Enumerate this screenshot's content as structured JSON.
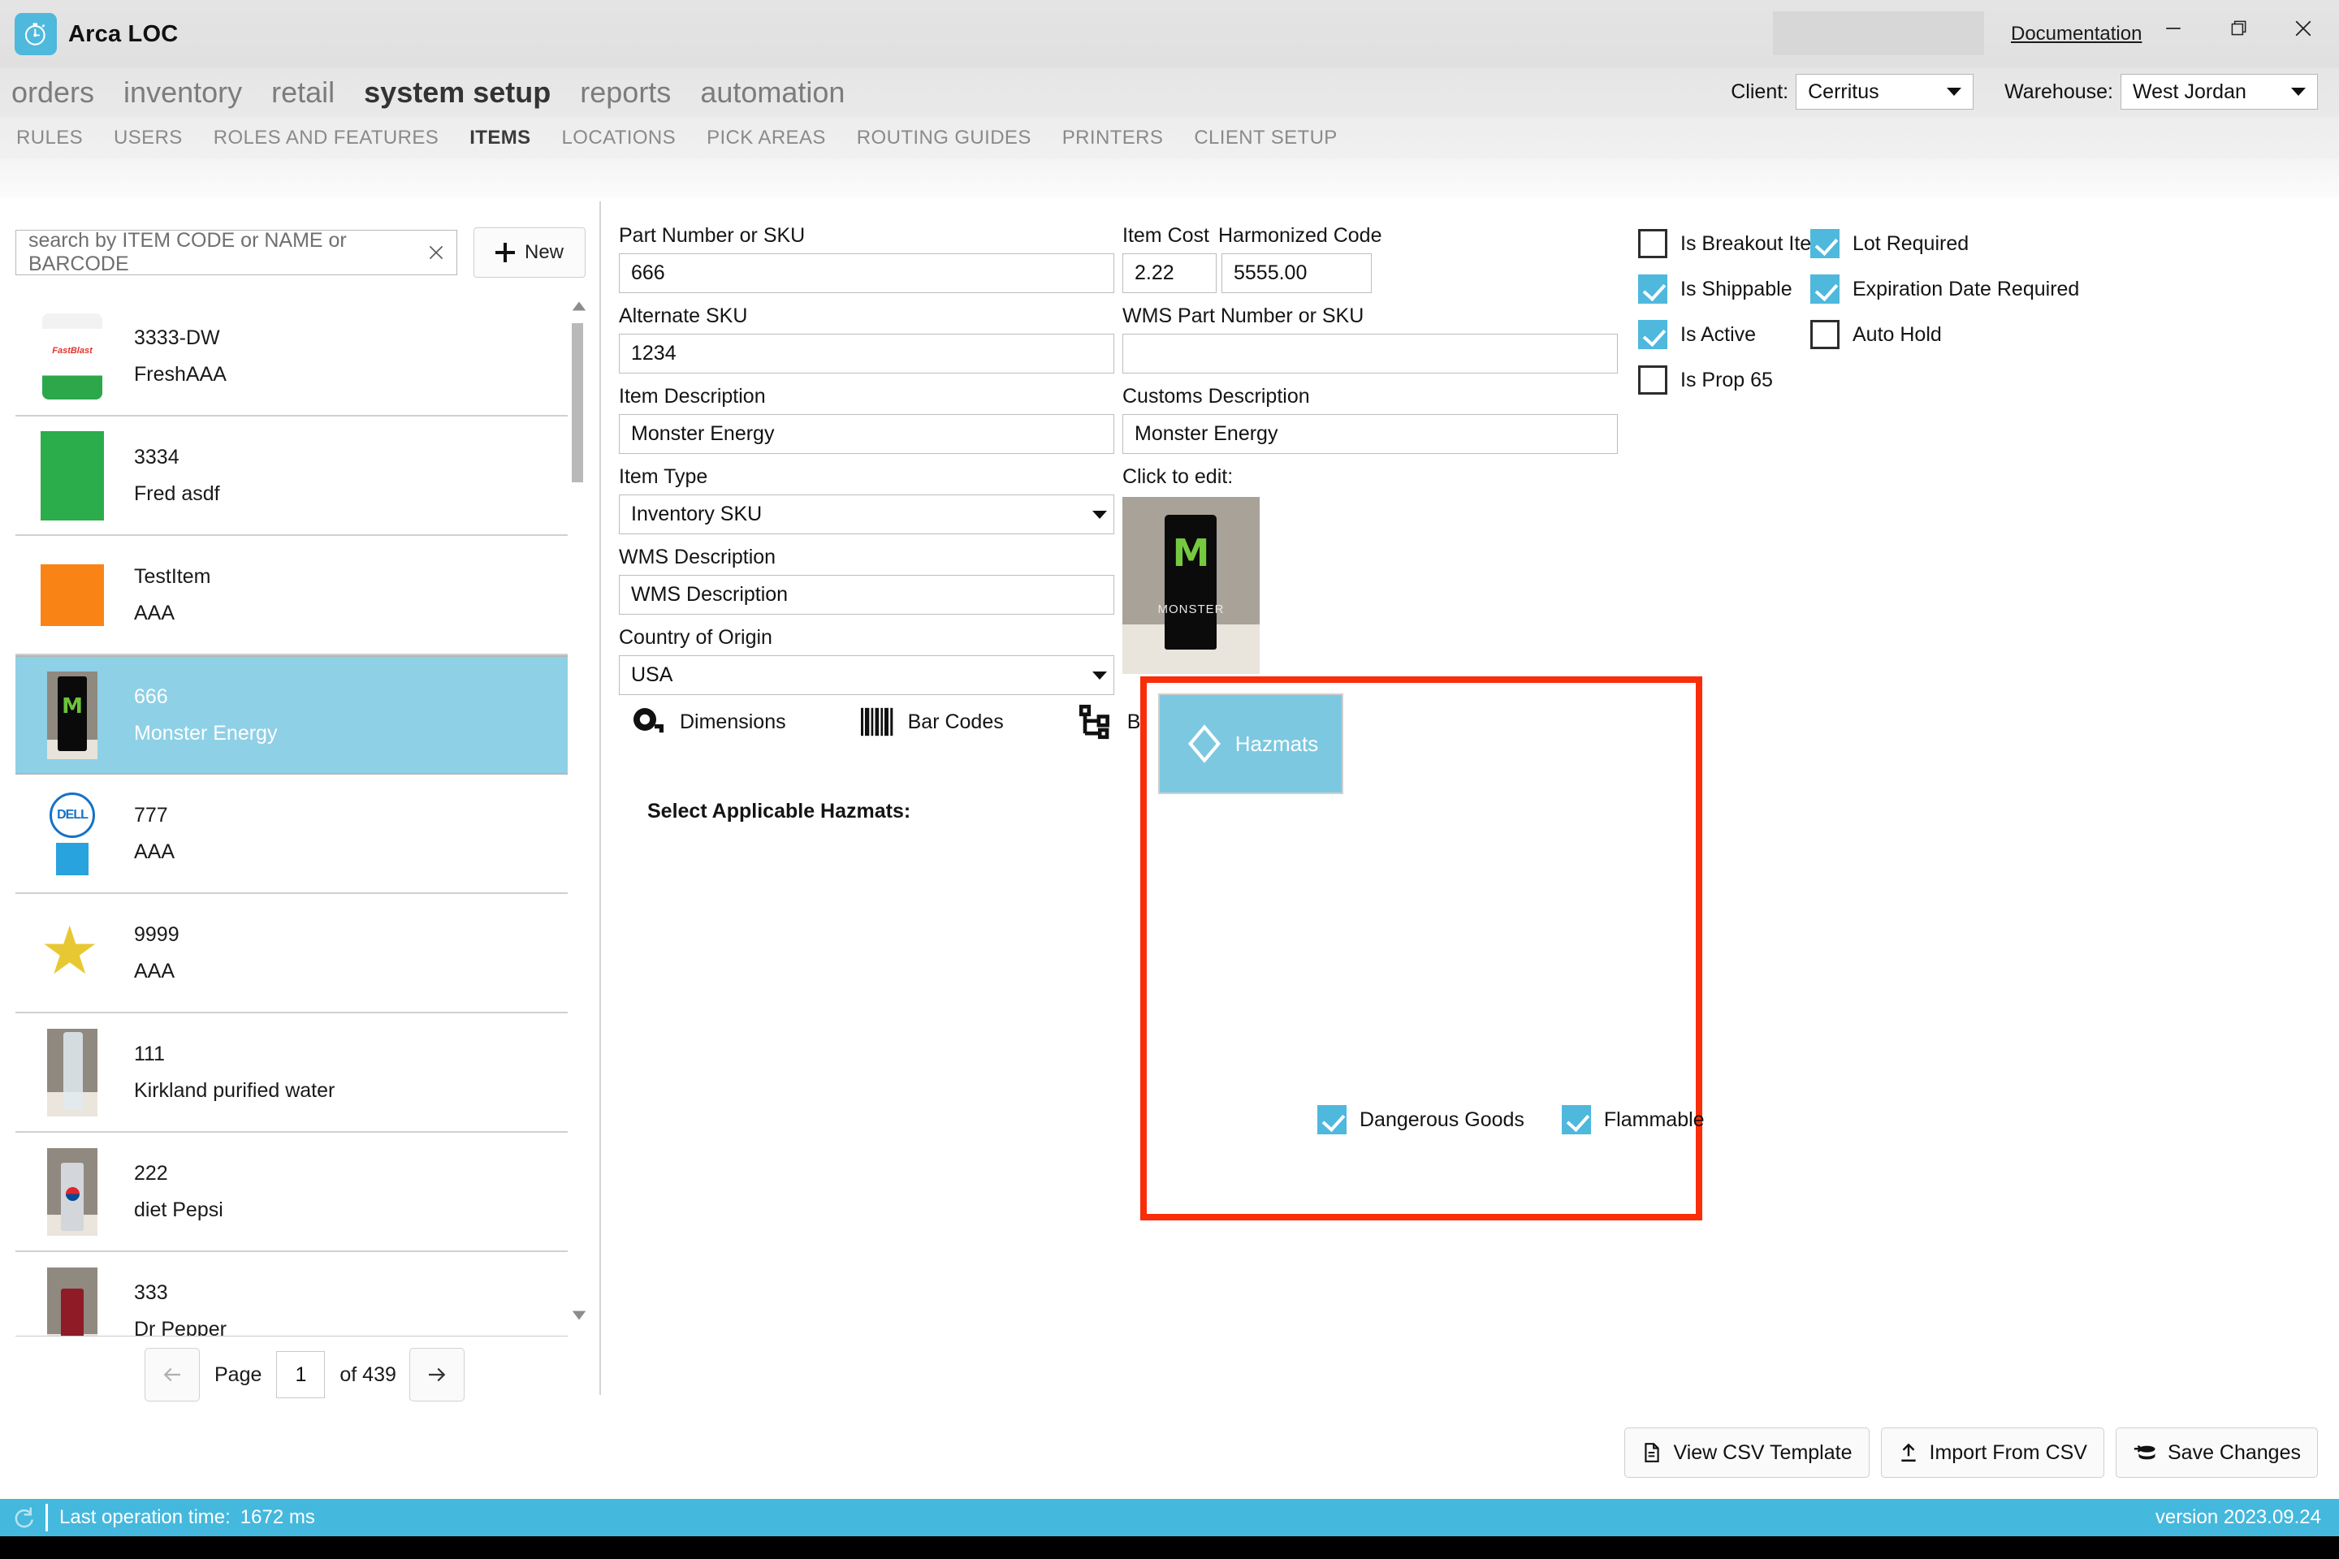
{
  "titlebar": {
    "app_title": "Arca LOC",
    "logo_icon": "stopwatch-icon",
    "documentation_link": "Documentation",
    "minimize_icon": "minimize-icon",
    "maximize_icon": "maximize-icon",
    "close_icon": "close-icon"
  },
  "mainnav": {
    "items": [
      {
        "label": "orders",
        "active": false
      },
      {
        "label": "inventory",
        "active": false
      },
      {
        "label": "retail",
        "active": false
      },
      {
        "label": "system setup",
        "active": true
      },
      {
        "label": "reports",
        "active": false
      },
      {
        "label": "automation",
        "active": false
      }
    ]
  },
  "context": {
    "client_label": "Client:",
    "client_value": "Cerritus",
    "warehouse_label": "Warehouse:",
    "warehouse_value": "West Jordan"
  },
  "subnav": {
    "items": [
      {
        "label": "RULES",
        "active": false
      },
      {
        "label": "USERS",
        "active": false
      },
      {
        "label": "ROLES AND FEATURES",
        "active": false
      },
      {
        "label": "ITEMS",
        "active": true
      },
      {
        "label": "LOCATIONS",
        "active": false
      },
      {
        "label": "PICK AREAS",
        "active": false
      },
      {
        "label": "ROUTING GUIDES",
        "active": false
      },
      {
        "label": "PRINTERS",
        "active": false
      },
      {
        "label": "CLIENT SETUP",
        "active": false
      }
    ]
  },
  "sidebar": {
    "search_placeholder": "search by ITEM CODE or NAME or BARCODE",
    "search_value": "",
    "clear_icon": "close-icon",
    "new_button": "New",
    "new_icon": "plus-icon",
    "items": [
      {
        "code": "3333-DW",
        "name": "FreshAAA",
        "thumb": "fastblast",
        "selected": false
      },
      {
        "code": "3334",
        "name": "Fred asdf",
        "thumb": "green",
        "selected": false
      },
      {
        "code": "TestItem",
        "name": "AAA",
        "thumb": "orange",
        "selected": false
      },
      {
        "code": "666",
        "name": "Monster Energy",
        "thumb": "monster",
        "selected": true
      },
      {
        "code": "777",
        "name": "AAA",
        "thumb": "dell",
        "selected": false
      },
      {
        "code": "9999",
        "name": "AAA",
        "thumb": "star",
        "selected": false
      },
      {
        "code": "111",
        "name": "Kirkland purified water",
        "thumb": "water",
        "selected": false
      },
      {
        "code": "222",
        "name": "diet Pepsi",
        "thumb": "pepsi",
        "selected": false
      },
      {
        "code": "333",
        "name": "Dr Pepper",
        "thumb": "drpepper",
        "selected": false
      }
    ],
    "pager": {
      "prev_icon": "arrow-left-icon",
      "next_icon": "arrow-right-icon",
      "page_label": "Page",
      "page_value": "1",
      "of_label": "of  439"
    }
  },
  "form": {
    "part_number_label": "Part Number or SKU",
    "part_number_value": "666",
    "alternate_sku_label": "Alternate SKU",
    "alternate_sku_value": "1234",
    "item_description_label": "Item Description",
    "item_description_value": "Monster Energy",
    "item_type_label": "Item Type",
    "item_type_value": "Inventory SKU",
    "wms_description_label": "WMS Description",
    "wms_description_value": "WMS Description",
    "country_of_origin_label": "Country of Origin",
    "country_of_origin_value": "USA",
    "item_cost_label": "Item Cost",
    "item_cost_value": "2.22",
    "harmonized_code_label": "Harmonized Code",
    "harmonized_code_value": "5555.00",
    "wms_part_number_label": "WMS Part Number or SKU",
    "wms_part_number_value": "",
    "customs_description_label": "Customs Description",
    "customs_description_value": "Monster Energy",
    "click_to_edit_label": "Click to edit:",
    "photo_alt": "Monster Energy can photo"
  },
  "flags": [
    {
      "label": "Is Breakout Item",
      "checked": false
    },
    {
      "label": "Lot Required",
      "checked": true
    },
    {
      "label": "Is Shippable",
      "checked": true
    },
    {
      "label": "Expiration Date Required",
      "checked": true
    },
    {
      "label": "Is Active",
      "checked": true
    },
    {
      "label": "Auto Hold",
      "checked": false
    },
    {
      "label": "Is Prop 65",
      "checked": false
    }
  ],
  "tools": [
    {
      "label": "Dimensions",
      "icon": "tape-measure-icon"
    },
    {
      "label": "Bar Codes",
      "icon": "barcode-icon"
    },
    {
      "label": "BOM",
      "icon": "bom-tree-icon"
    }
  ],
  "hazmats": {
    "section_label": "Select Applicable Hazmats:",
    "tile_label": "Hazmats",
    "tile_icon": "diamond-icon",
    "options": [
      {
        "label": "Dangerous Goods",
        "checked": true
      },
      {
        "label": "Flammable",
        "checked": true
      }
    ]
  },
  "actions": [
    {
      "label": "View CSV Template",
      "icon": "document-icon"
    },
    {
      "label": "Import From CSV",
      "icon": "upload-icon"
    },
    {
      "label": "Save Changes",
      "icon": "database-save-icon"
    }
  ],
  "statusbar": {
    "refresh_icon": "refresh-icon",
    "last_operation_label": "Last operation time:",
    "last_operation_value": "1672 ms",
    "version": "version 2023.09.24"
  },
  "colors": {
    "accent": "#45b8dd",
    "selection": "#8ed0e6",
    "hazmat_highlight": "#f92d09",
    "tile": "#7cc8e0"
  }
}
